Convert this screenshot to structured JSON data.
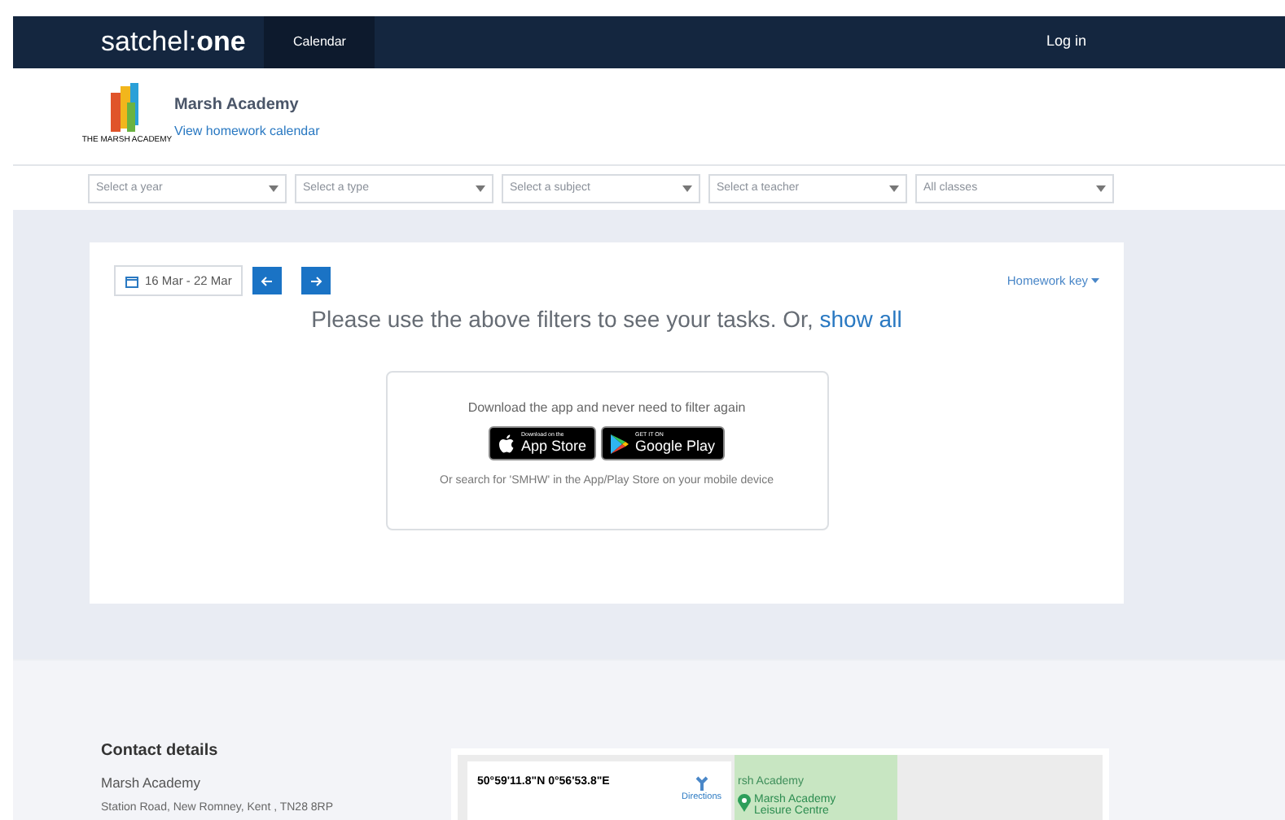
{
  "navbar": {
    "logo": "satchel:**one**",
    "tabs": [
      {
        "label": "Calendar",
        "selected": true
      }
    ],
    "login": "Log in"
  },
  "school": {
    "name": "Marsh Academy",
    "logo_caption": "THE MARSH ACADEMY",
    "link": "View homework calendar"
  },
  "filters": [
    {
      "placeholder": "Select a year"
    },
    {
      "placeholder": "Select a type"
    },
    {
      "placeholder": "Select a subject"
    },
    {
      "placeholder": "Select a teacher"
    },
    {
      "placeholder": "All classes"
    }
  ],
  "calendar": {
    "date_range": "16 Mar - 22 Mar",
    "homework_key": "Homework key",
    "message": "Please use the above filters to see your tasks. Or,",
    "show_all": "show all"
  },
  "app_promo": {
    "heading": "Download the app and never need to filter again",
    "stores": [
      {
        "kind": "apple",
        "small": "Download on the",
        "big": "App Store"
      },
      {
        "kind": "google",
        "small": "GET IT ON",
        "big": "Google Play"
      }
    ],
    "hint": "Or search for 'SMHW' in the App/Play Store on your mobile device"
  },
  "contact": {
    "title": "Contact details",
    "name": "Marsh Academy",
    "address": "Station Road, New Romney, Kent , TN28 8RP"
  },
  "map": {
    "coordinates": "50°59'11.8\"N 0°56'53.8\"E",
    "directions": "Directions",
    "label_cut": "rsh Academy",
    "place": "Marsh Academy Leisure Centre"
  }
}
